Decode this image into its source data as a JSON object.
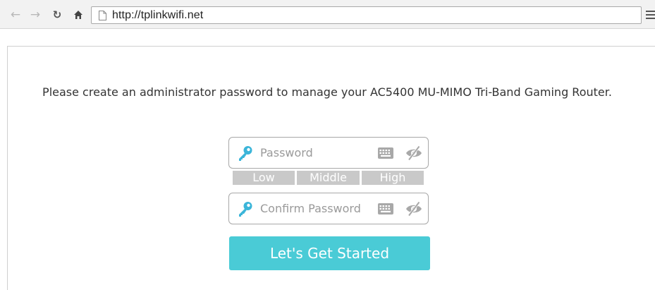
{
  "browser": {
    "url": "http://tplinkwifi.net",
    "back_icon": "arrow-left-icon",
    "forward_icon": "arrow-right-icon",
    "reload_icon": "reload-icon",
    "home_icon": "home-icon",
    "page_icon": "page-icon",
    "menu_icon": "hamburger-menu-icon"
  },
  "page": {
    "instructions": "Please create an administrator password to manage your AC5400 MU-MIMO Tri-Band Gaming Router.",
    "password_placeholder": "Password",
    "confirm_placeholder": "Confirm Password",
    "strength": {
      "low": "Low",
      "middle": "Middle",
      "high": "High",
      "level": 0
    },
    "submit_label": "Let's Get Started"
  },
  "colors": {
    "accent": "#4acbd6",
    "key_icon": "#3bb5d9",
    "strength_inactive": "#c9c9c9",
    "icon_gray": "#a8a8a8"
  }
}
